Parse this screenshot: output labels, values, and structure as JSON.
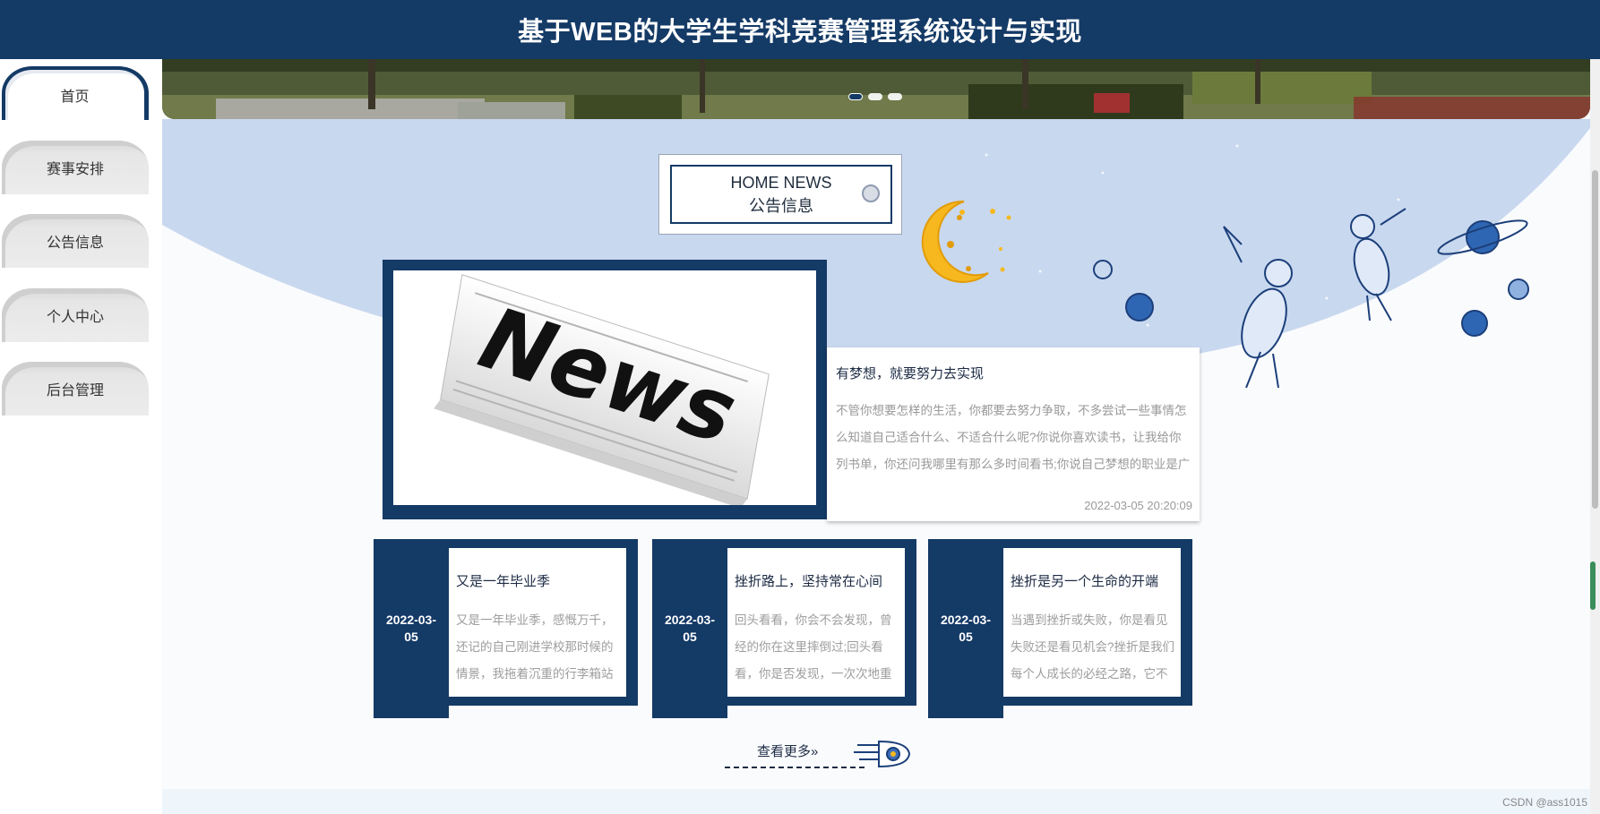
{
  "header": {
    "title": "基于WEB的大学生学科竞赛管理系统设计与实现"
  },
  "sidebar": {
    "items": [
      {
        "label": "首页",
        "active": true
      },
      {
        "label": "赛事安排",
        "active": false
      },
      {
        "label": "公告信息",
        "active": false
      },
      {
        "label": "个人中心",
        "active": false
      },
      {
        "label": "后台管理",
        "active": false
      }
    ]
  },
  "section": {
    "title_en": "HOME NEWS",
    "title_cn": "公告信息"
  },
  "featured": {
    "title": "有梦想，就要努力去实现",
    "body": "不管你想要怎样的生活，你都要去努力争取，不多尝试一些事情怎么知道自己适合什么、不适合什么呢?你说你喜欢读书，让我给你列书单，你还问我哪里有那么多时间看书;你说自己梦想的职业是广告…",
    "date": "2022-03-05 20:20:09",
    "image_text": "News"
  },
  "news": [
    {
      "date_line1": "2022-03-",
      "date_line2": "05",
      "title": "又是一年毕业季",
      "body": "又是一年毕业季，感慨万千，还记的自己刚进学校那时候的情景，我拖着沉重的行李箱站在…"
    },
    {
      "date_line1": "2022-03-",
      "date_line2": "05",
      "title": "挫折路上，坚持常在心间",
      "body": "回头看看，你会不会发现，曾经的你在这里摔倒过;回头看看，你是否发现，一次次地重复着…"
    },
    {
      "date_line1": "2022-03-",
      "date_line2": "05",
      "title": "挫折是另一个生命的开端",
      "body": "当遇到挫折或失败，你是看见失败还是看见机会?挫折是我们每个人成长的必经之路，它不是…"
    }
  ],
  "more": {
    "label": "查看更多»"
  },
  "watermark": "CSDN @ass1015",
  "colors": {
    "primary": "#143a66",
    "sky": "#c8d8ef",
    "moon": "#f6b81e"
  }
}
